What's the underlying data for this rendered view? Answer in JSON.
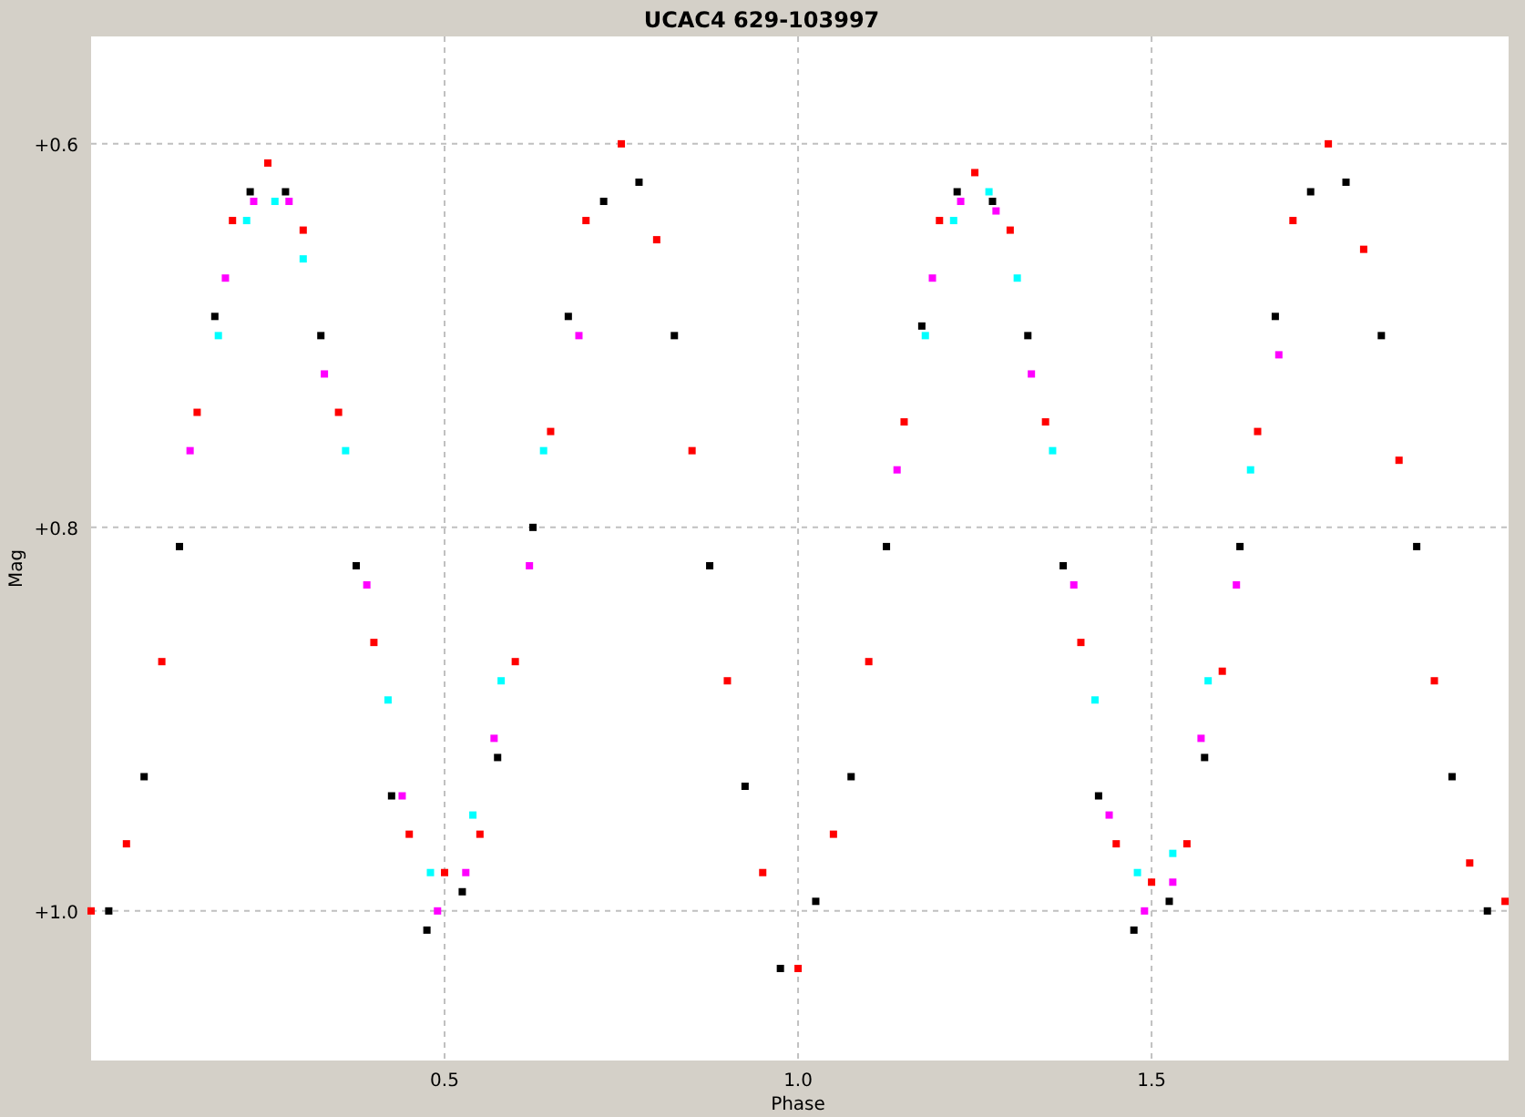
{
  "chart": {
    "chart_data": {
      "type": "scatter",
      "title": "UCAC4 629-103997",
      "xlabel": "Phase",
      "ylabel": "Mag",
      "xlim": [
        0,
        2.005
      ],
      "ylim": [
        1.078,
        0.544
      ],
      "grid": true,
      "xticks": [
        {
          "value": 0.5,
          "label": "0.5"
        },
        {
          "value": 1.0,
          "label": "1.0"
        },
        {
          "value": 1.5,
          "label": "1.5"
        }
      ],
      "yticks": [
        {
          "value": 0.6,
          "label": "+0.6"
        },
        {
          "value": 0.8,
          "label": "+0.8"
        },
        {
          "value": 1.0,
          "label": "+1.0"
        }
      ],
      "series": [
        {
          "color": "#ff0000",
          "x": [
            0,
            0.05,
            0.1,
            0.15,
            0.2,
            0.25,
            0.3,
            0.35,
            0.4,
            0.45,
            0.5,
            0.55,
            0.6,
            0.65,
            0.7,
            0.75,
            0.8,
            0.85,
            0.9,
            0.95,
            1.0,
            1.05,
            1.1,
            1.15,
            1.2,
            1.25,
            1.3,
            1.35,
            1.4,
            1.45,
            1.5,
            1.55,
            1.6,
            1.65,
            1.7,
            1.75,
            1.8,
            1.85,
            1.9,
            1.95,
            2.0
          ],
          "values": [
            1.0,
            0.965,
            0.87,
            0.74,
            0.64,
            0.61,
            0.645,
            0.74,
            0.86,
            0.96,
            0.98,
            0.96,
            0.87,
            0.75,
            0.64,
            0.6,
            0.65,
            0.76,
            0.88,
            0.98,
            1.03,
            0.96,
            0.87,
            0.745,
            0.64,
            0.615,
            0.645,
            0.745,
            0.86,
            0.965,
            0.985,
            0.965,
            0.875,
            0.75,
            0.64,
            0.6,
            0.655,
            0.765,
            0.88,
            0.975,
            0.995
          ]
        },
        {
          "color": "#000000",
          "x": [
            0.025,
            0.075,
            0.125,
            0.175,
            0.225,
            0.275,
            0.325,
            0.375,
            0.425,
            0.475,
            0.525,
            0.575,
            0.625,
            0.675,
            0.725,
            0.775,
            0.825,
            0.875,
            0.925,
            0.975,
            1.025,
            1.075,
            1.125,
            1.175,
            1.225,
            1.275,
            1.325,
            1.375,
            1.425,
            1.475,
            1.525,
            1.575,
            1.625,
            1.675,
            1.725,
            1.775,
            1.825,
            1.875,
            1.925,
            1.975
          ],
          "values": [
            1.0,
            0.93,
            0.81,
            0.69,
            0.625,
            0.625,
            0.7,
            0.82,
            0.94,
            1.01,
            0.99,
            0.92,
            0.8,
            0.69,
            0.63,
            0.62,
            0.7,
            0.82,
            0.935,
            1.03,
            0.995,
            0.93,
            0.81,
            0.695,
            0.625,
            0.63,
            0.7,
            0.82,
            0.94,
            1.01,
            0.995,
            0.92,
            0.81,
            0.69,
            0.625,
            0.62,
            0.7,
            0.81,
            0.93,
            1.0
          ]
        },
        {
          "color": "#00ffff",
          "x": [
            0.18,
            0.22,
            0.26,
            0.3,
            0.36,
            0.42,
            0.48,
            0.54,
            0.58,
            0.64,
            1.18,
            1.22,
            1.27,
            1.31,
            1.36,
            1.42,
            1.48,
            1.53,
            1.58,
            1.64
          ],
          "values": [
            0.7,
            0.64,
            0.63,
            0.66,
            0.76,
            0.89,
            0.98,
            0.95,
            0.88,
            0.76,
            0.7,
            0.64,
            0.625,
            0.67,
            0.76,
            0.89,
            0.98,
            0.97,
            0.88,
            0.77
          ]
        },
        {
          "color": "#ff00ff",
          "x": [
            0.14,
            0.19,
            0.23,
            0.28,
            0.33,
            0.39,
            0.44,
            0.49,
            0.53,
            0.57,
            0.62,
            0.69,
            1.14,
            1.19,
            1.23,
            1.28,
            1.33,
            1.39,
            1.44,
            1.49,
            1.53,
            1.57,
            1.62,
            1.68
          ],
          "values": [
            0.76,
            0.67,
            0.63,
            0.63,
            0.72,
            0.83,
            0.94,
            1.0,
            0.98,
            0.91,
            0.82,
            0.7,
            0.77,
            0.67,
            0.63,
            0.635,
            0.72,
            0.83,
            0.95,
            1.0,
            0.985,
            0.91,
            0.83,
            0.71
          ]
        }
      ]
    }
  }
}
